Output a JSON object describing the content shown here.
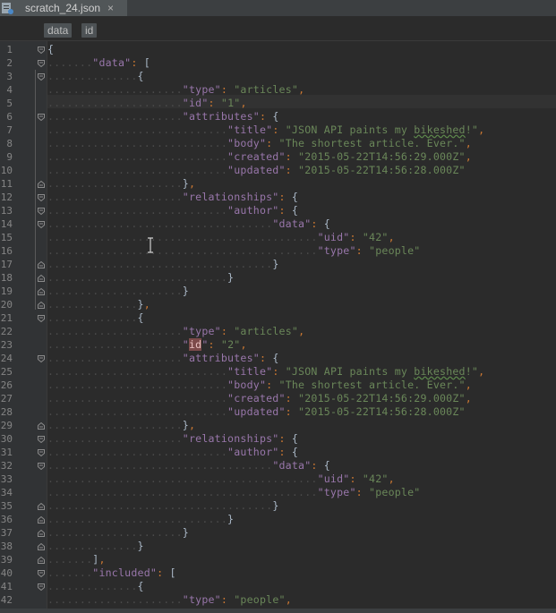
{
  "tab": {
    "filename": "scratch_24.json",
    "close_glyph": "×",
    "icon": "json-file-icon"
  },
  "breadcrumb": [
    {
      "label": "data"
    },
    {
      "label": "id"
    }
  ],
  "colors": {
    "key": "#9876aa",
    "string": "#6a8759",
    "punct": "#cc7832",
    "bracket": "#a9b7c6",
    "background": "#2b2b2b",
    "gutter": "#313335",
    "highlight": "#7c4a4a"
  },
  "code_lines": [
    {
      "n": "1",
      "t": [
        [
          "b",
          "{"
        ]
      ]
    },
    {
      "n": "2",
      "t": [
        [
          "k",
          "\"data\""
        ],
        [
          "p",
          ": "
        ],
        [
          "b",
          "["
        ]
      ]
    },
    {
      "n": "3",
      "t": [
        [
          "b",
          "{"
        ]
      ]
    },
    {
      "n": "4",
      "t": [
        [
          "k",
          "\"type\""
        ],
        [
          "p",
          ": "
        ],
        [
          "s",
          "\"articles\""
        ],
        [
          "p",
          ","
        ]
      ]
    },
    {
      "n": "5",
      "t": [
        [
          "k",
          "\"id\""
        ],
        [
          "p",
          ": "
        ],
        [
          "s",
          "\"1\""
        ],
        [
          "p",
          ","
        ]
      ]
    },
    {
      "n": "6",
      "t": [
        [
          "k",
          "\"attributes\""
        ],
        [
          "p",
          ": "
        ],
        [
          "b",
          "{"
        ]
      ]
    },
    {
      "n": "7",
      "t": [
        [
          "k",
          "\"title\""
        ],
        [
          "p",
          ": "
        ],
        [
          "s",
          "\"JSON API paints my bikeshed!\""
        ],
        [
          "p",
          ","
        ]
      ]
    },
    {
      "n": "8",
      "t": [
        [
          "k",
          "\"body\""
        ],
        [
          "p",
          ": "
        ],
        [
          "s",
          "\"The shortest article. Ever.\""
        ],
        [
          "p",
          ","
        ]
      ]
    },
    {
      "n": "9",
      "t": [
        [
          "k",
          "\"created\""
        ],
        [
          "p",
          ": "
        ],
        [
          "s",
          "\"2015-05-22T14:56:29.000Z\""
        ],
        [
          "p",
          ","
        ]
      ]
    },
    {
      "n": "10",
      "t": [
        [
          "k",
          "\"updated\""
        ],
        [
          "p",
          ": "
        ],
        [
          "s",
          "\"2015-05-22T14:56:28.000Z\""
        ]
      ]
    },
    {
      "n": "11",
      "t": [
        [
          "b",
          "}"
        ],
        [
          "p",
          ","
        ]
      ]
    },
    {
      "n": "12",
      "t": [
        [
          "k",
          "\"relationships\""
        ],
        [
          "p",
          ": "
        ],
        [
          "b",
          "{"
        ]
      ]
    },
    {
      "n": "13",
      "t": [
        [
          "k",
          "\"author\""
        ],
        [
          "p",
          ": "
        ],
        [
          "b",
          "{"
        ]
      ]
    },
    {
      "n": "14",
      "t": [
        [
          "k",
          "\"data\""
        ],
        [
          "p",
          ": "
        ],
        [
          "b",
          "{"
        ]
      ]
    },
    {
      "n": "15",
      "t": [
        [
          "k",
          "\"uid\""
        ],
        [
          "p",
          ": "
        ],
        [
          "s",
          "\"42\""
        ],
        [
          "p",
          ","
        ]
      ]
    },
    {
      "n": "16",
      "t": [
        [
          "k",
          "\"type\""
        ],
        [
          "p",
          ": "
        ],
        [
          "s",
          "\"people\""
        ]
      ]
    },
    {
      "n": "17",
      "t": [
        [
          "b",
          "}"
        ]
      ]
    },
    {
      "n": "18",
      "t": [
        [
          "b",
          "}"
        ]
      ]
    },
    {
      "n": "19",
      "t": [
        [
          "b",
          "}"
        ]
      ]
    },
    {
      "n": "20",
      "t": [
        [
          "b",
          "}"
        ],
        [
          "p",
          ","
        ]
      ]
    },
    {
      "n": "21",
      "t": [
        [
          "b",
          "{"
        ]
      ]
    },
    {
      "n": "22",
      "t": [
        [
          "k",
          "\"type\""
        ],
        [
          "p",
          ": "
        ],
        [
          "s",
          "\"articles\""
        ],
        [
          "p",
          ","
        ]
      ]
    },
    {
      "n": "23",
      "t": [
        [
          "k",
          "\""
        ],
        [
          "h",
          "id"
        ],
        [
          "k",
          "\""
        ],
        [
          "p",
          ": "
        ],
        [
          "s",
          "\"2\""
        ],
        [
          "p",
          ","
        ]
      ]
    },
    {
      "n": "24",
      "t": [
        [
          "k",
          "\"attributes\""
        ],
        [
          "p",
          ": "
        ],
        [
          "b",
          "{"
        ]
      ]
    },
    {
      "n": "25",
      "t": [
        [
          "k",
          "\"title\""
        ],
        [
          "p",
          ": "
        ],
        [
          "s",
          "\"JSON API paints my bikeshed!\""
        ],
        [
          "p",
          ","
        ]
      ]
    },
    {
      "n": "26",
      "t": [
        [
          "k",
          "\"body\""
        ],
        [
          "p",
          ": "
        ],
        [
          "s",
          "\"The shortest article. Ever.\""
        ],
        [
          "p",
          ","
        ]
      ]
    },
    {
      "n": "27",
      "t": [
        [
          "k",
          "\"created\""
        ],
        [
          "p",
          ": "
        ],
        [
          "s",
          "\"2015-05-22T14:56:29.000Z\""
        ],
        [
          "p",
          ","
        ]
      ]
    },
    {
      "n": "28",
      "t": [
        [
          "k",
          "\"updated\""
        ],
        [
          "p",
          ": "
        ],
        [
          "s",
          "\"2015-05-22T14:56:28.000Z\""
        ]
      ]
    },
    {
      "n": "29",
      "t": [
        [
          "b",
          "}"
        ],
        [
          "p",
          ","
        ]
      ]
    },
    {
      "n": "30",
      "t": [
        [
          "k",
          "\"relationships\""
        ],
        [
          "p",
          ": "
        ],
        [
          "b",
          "{"
        ]
      ]
    },
    {
      "n": "31",
      "t": [
        [
          "k",
          "\"author\""
        ],
        [
          "p",
          ": "
        ],
        [
          "b",
          "{"
        ]
      ]
    },
    {
      "n": "32",
      "t": [
        [
          "k",
          "\"data\""
        ],
        [
          "p",
          ": "
        ],
        [
          "b",
          "{"
        ]
      ]
    },
    {
      "n": "33",
      "t": [
        [
          "k",
          "\"uid\""
        ],
        [
          "p",
          ": "
        ],
        [
          "s",
          "\"42\""
        ],
        [
          "p",
          ","
        ]
      ]
    },
    {
      "n": "34",
      "t": [
        [
          "k",
          "\"type\""
        ],
        [
          "p",
          ": "
        ],
        [
          "s",
          "\"people\""
        ]
      ]
    },
    {
      "n": "35",
      "t": [
        [
          "b",
          "}"
        ]
      ]
    },
    {
      "n": "36",
      "t": [
        [
          "b",
          "}"
        ]
      ]
    },
    {
      "n": "37",
      "t": [
        [
          "b",
          "}"
        ]
      ]
    },
    {
      "n": "38",
      "t": [
        [
          "b",
          "}"
        ]
      ]
    },
    {
      "n": "39",
      "t": [
        [
          "b",
          "]"
        ],
        [
          "p",
          ","
        ]
      ]
    },
    {
      "n": "40",
      "t": [
        [
          "k",
          "\"included\""
        ],
        [
          "p",
          ": "
        ],
        [
          "b",
          "["
        ]
      ]
    },
    {
      "n": "41",
      "t": [
        [
          "b",
          "{"
        ]
      ]
    },
    {
      "n": "42",
      "t": [
        [
          "k",
          "\"type\""
        ],
        [
          "p",
          ": "
        ],
        [
          "s",
          "\"people\""
        ],
        [
          "p",
          ","
        ]
      ]
    }
  ]
}
